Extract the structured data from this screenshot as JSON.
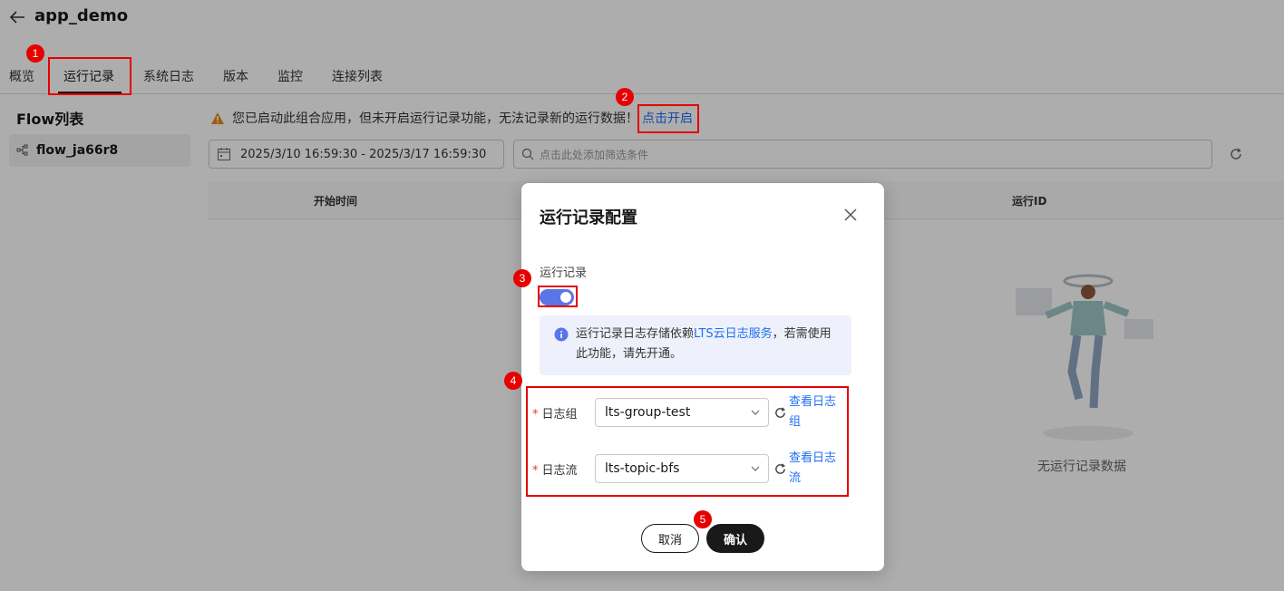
{
  "header": {
    "title": "app_demo"
  },
  "tabs": [
    {
      "label": "概览"
    },
    {
      "label": "运行记录"
    },
    {
      "label": "系统日志"
    },
    {
      "label": "版本"
    },
    {
      "label": "监控"
    },
    {
      "label": "连接列表"
    }
  ],
  "sidebar": {
    "title": "Flow列表",
    "items": [
      {
        "label": "flow_ja66r8"
      }
    ]
  },
  "notice": {
    "text": "您已启动此组合应用，但未开启运行记录功能，无法记录新的运行数据！",
    "link": "点击开启"
  },
  "filters": {
    "date_range": "2025/3/10 16:59:30 - 2025/3/17 16:59:30",
    "search_placeholder": "点击此处添加筛选条件"
  },
  "table": {
    "columns": [
      "开始时间",
      "运行ID"
    ],
    "empty_text": "无运行记录数据"
  },
  "dialog": {
    "title": "运行记录配置",
    "run_record_label": "运行记录",
    "toggle_on": true,
    "info_prefix": "运行记录日志存储依赖",
    "info_link": "LTS云日志服务",
    "info_suffix": "，若需使用此功能，请先开通。",
    "log_group": {
      "label": "日志组",
      "value": "lts-group-test",
      "link": "查看日志组"
    },
    "log_stream": {
      "label": "日志流",
      "value": "lts-topic-bfs",
      "link": "查看日志流"
    },
    "cancel": "取消",
    "confirm": "确认"
  },
  "annotations": [
    "1",
    "2",
    "3",
    "4",
    "5"
  ],
  "colors": {
    "accent": "#5b74e8",
    "link": "#1f6ef2",
    "mark": "#e60000",
    "primary_button": "#191919"
  }
}
